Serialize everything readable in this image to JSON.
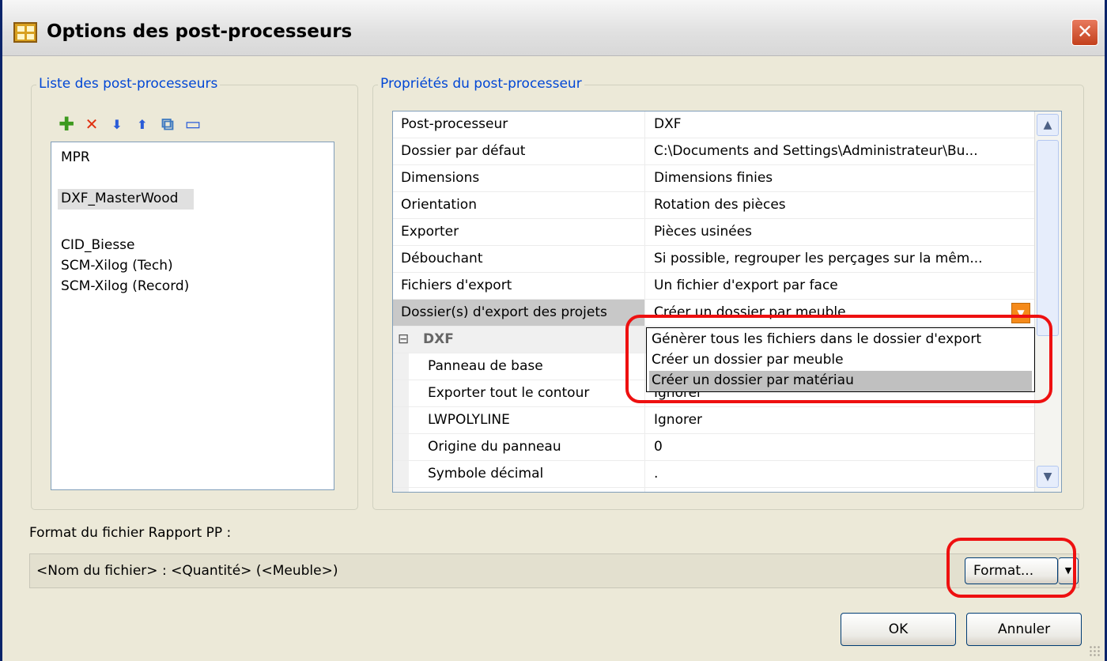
{
  "window": {
    "title": "Options des post-processeurs",
    "close_glyph": "✕"
  },
  "list_group": {
    "title": "Liste des post-processeurs",
    "toolbar": [
      {
        "icon": "add-icon",
        "glyph": "✚",
        "color": "#3c9a1e"
      },
      {
        "icon": "delete-icon",
        "glyph": "✕",
        "color": "#e03010"
      },
      {
        "icon": "move-down-icon",
        "glyph": "⬇",
        "color": "#2a5cd8"
      },
      {
        "icon": "move-up-icon",
        "glyph": "⬆",
        "color": "#2a5cd8"
      },
      {
        "icon": "copy-icon",
        "glyph": "⧉",
        "color": "#3c78c0"
      },
      {
        "icon": "rename-icon",
        "glyph": "▭",
        "color": "#2a5cd8"
      }
    ],
    "items": [
      "MPR",
      "DXF_MasterWood",
      "CID_Biesse",
      "SCM-Xilog (Tech)",
      "SCM-Xilog (Record)"
    ],
    "selected": "DXF_MasterWood"
  },
  "props_group": {
    "title": "Propriétés du post-processeur",
    "rows": [
      {
        "name": "Post-processeur",
        "value": "DXF"
      },
      {
        "name": "Dossier par défaut",
        "value": "C:\\Documents and Settings\\Administrateur\\Bu..."
      },
      {
        "name": "Dimensions",
        "value": "Dimensions finies"
      },
      {
        "name": "Orientation",
        "value": "Rotation des pièces"
      },
      {
        "name": "Exporter",
        "value": "Pièces usinées"
      },
      {
        "name": "Débouchant",
        "value": "Si possible, regrouper les perçages sur la mêm..."
      },
      {
        "name": "Fichiers d'export",
        "value": "Un fichier d'export par face"
      },
      {
        "name": "Dossier(s) d'export des projets",
        "value": "Créer un dossier par meuble"
      }
    ],
    "category": {
      "name": "DXF",
      "toggle": "⊟"
    },
    "sub_rows": [
      {
        "name": "Panneau de base",
        "value": ""
      },
      {
        "name": "Exporter tout le contour",
        "value": "Ignorer"
      },
      {
        "name": "LWPOLYLINE",
        "value": "Ignorer"
      },
      {
        "name": "Origine du panneau",
        "value": "0"
      },
      {
        "name": "Symbole décimal",
        "value": "."
      }
    ],
    "dropdown_options": [
      "Génèrer tous les fichiers dans le dossier d'export",
      "Créer un dossier par meuble",
      "Créer un dossier par matériau"
    ],
    "dropdown_highlighted_index": 2
  },
  "report": {
    "label": "Format du fichier Rapport PP :",
    "value": "<Nom du fichier> : <Quantité> (<Meuble>)",
    "format_button": "Format..."
  },
  "buttons": {
    "ok": "OK",
    "cancel": "Annuler"
  },
  "colors": {
    "highlight_red": "#ee1010",
    "group_title": "#0046d5",
    "dropdown_button": "#f58a1a"
  }
}
